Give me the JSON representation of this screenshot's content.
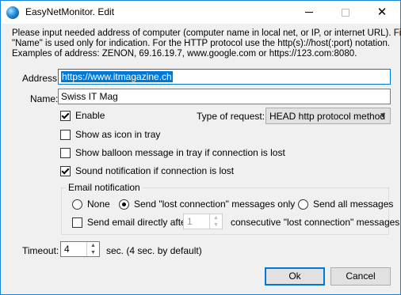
{
  "window": {
    "title": "EasyNetMonitor. Edit",
    "icon": "globe-icon",
    "controls": {
      "minimize": "minimize-icon",
      "maximize": "maximize-icon",
      "close": "✕"
    }
  },
  "intro": [
    "Please input needed address of computer (computer name in local net, or IP, or internet URL). Field",
    "\"Name\" is used only for indication. For the HTTP protocol use the http(s)://host(:port) notation.",
    "Examples of address:   ZENON, 69.16.19.7,  www.google.com or https://123.com:8080."
  ],
  "address": {
    "label": "Address:",
    "value": "https://www.itmagazine.ch"
  },
  "name": {
    "label": "Name:",
    "value": "Swiss IT Mag"
  },
  "enable": {
    "label": "Enable",
    "checked": true
  },
  "request_type": {
    "label": "Type of request:",
    "selected": "HEAD http protocol method"
  },
  "show_icon": {
    "label": "Show as icon in tray",
    "checked": false
  },
  "show_balloon": {
    "label": "Show balloon message in tray if connection is lost",
    "checked": false
  },
  "sound": {
    "label": "Sound notification if connection is lost",
    "checked": true
  },
  "email": {
    "group_label": "Email notification",
    "options": [
      {
        "label": "None",
        "selected": false
      },
      {
        "label": "Send \"lost connection\" messages only",
        "selected": true
      },
      {
        "label": "Send all messages",
        "selected": false
      }
    ],
    "send_directly": {
      "label": "Send email directly after",
      "checked": false
    },
    "count": "1",
    "count_suffix": "consecutive \"lost connection\" messages"
  },
  "timeout": {
    "label": "Timeout:",
    "value": "4",
    "suffix": "sec. (4 sec. by default)"
  },
  "buttons": {
    "ok": "Ok",
    "cancel": "Cancel"
  },
  "colors": {
    "accent": "#0078d7",
    "background": "#f0f0f0"
  }
}
